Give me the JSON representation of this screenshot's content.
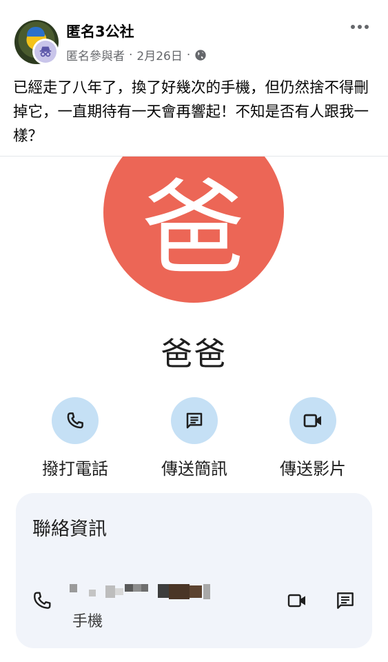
{
  "post": {
    "group_name": "匿名3公社",
    "author": "匿名參與者",
    "separator": "·",
    "date": "2月26日",
    "privacy_icon": "globe-icon",
    "text": "已經走了八年了，換了好幾次的手機，但仍然捨不得刪掉它，一直期待有一天會再響起！不知是否有人跟我一樣？"
  },
  "contact": {
    "avatar_letter": "爸",
    "avatar_color": "#ec6656",
    "name": "爸爸",
    "actions": [
      {
        "label": "撥打電話",
        "icon": "phone-icon"
      },
      {
        "label": "傳送簡訊",
        "icon": "message-icon"
      },
      {
        "label": "傳送影片",
        "icon": "video-icon"
      }
    ],
    "info_title": "聯絡資訊",
    "number_type": "手機",
    "action_color": "#c5e0f5"
  }
}
